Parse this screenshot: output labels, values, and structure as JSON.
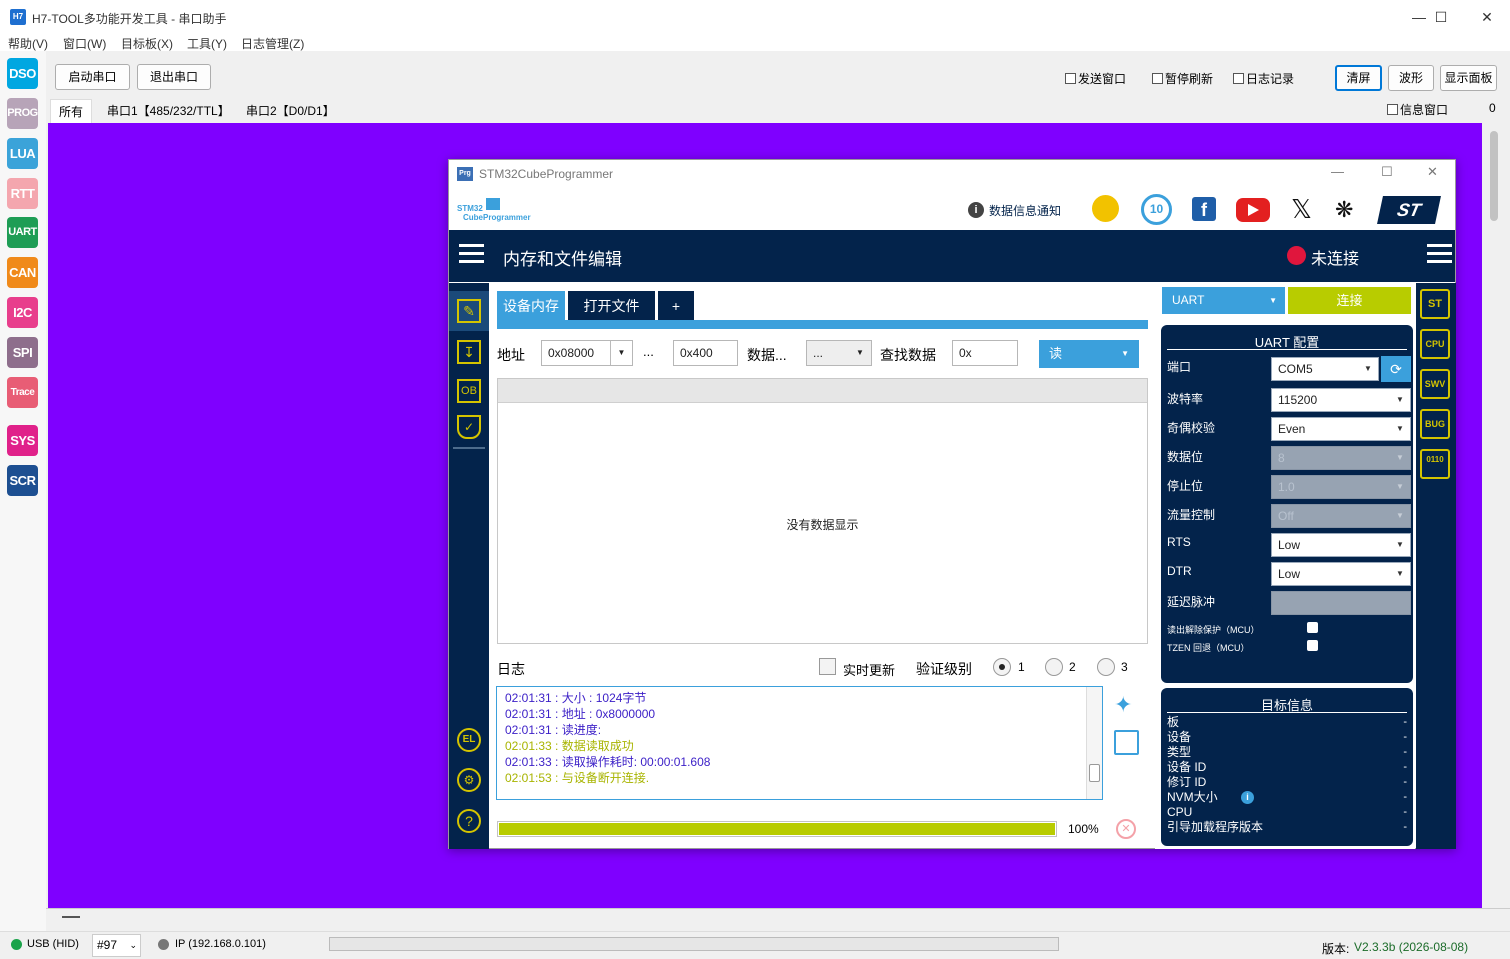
{
  "window": {
    "icon_text": "H7",
    "title": "H7-TOOL多功能开发工具 - 串口助手"
  },
  "menu": [
    "帮助(V)",
    "窗口(W)",
    "目标板(X)",
    "工具(Y)",
    "日志管理(Z)"
  ],
  "left_modes": [
    {
      "label": "DSO",
      "color": "#00a7e1"
    },
    {
      "label": "PROG",
      "color": "#b7a4b8"
    },
    {
      "label": "LUA",
      "color": "#3ba3d9"
    },
    {
      "label": "RTT",
      "color": "#f4a6ae"
    },
    {
      "label": "UART",
      "color": "#1e9d55"
    },
    {
      "label": "CAN",
      "color": "#f08a1a"
    },
    {
      "label": "I2C",
      "color": "#e83e8c"
    },
    {
      "label": "SPI",
      "color": "#8e6e8c"
    },
    {
      "label": "Trace",
      "color": "#e85d75"
    },
    {
      "label": "SYS",
      "color": "#e0218a"
    },
    {
      "label": "SCR",
      "color": "#1d4f91"
    }
  ],
  "toolbar": {
    "start_port": "启动串口",
    "exit_port": "退出串口",
    "send_window": "发送窗口",
    "pause_refresh": "暂停刷新",
    "log_record": "日志记录",
    "clear": "清屏",
    "wave": "波形",
    "show_panel": "显示面板",
    "info_window": "信息窗口",
    "info_count": "0"
  },
  "tabs": [
    "所有",
    "串口1【485/232/TTL】",
    "串口2【D0/D1】"
  ],
  "status": {
    "usb": "USB (HID)",
    "port_num": "#97",
    "ip": "IP (192.168.0.101)",
    "version_label": "版本:",
    "version_value": "V2.3.3b (2026-08-08)"
  },
  "stm": {
    "title": "STM32CubeProgrammer",
    "icon_text": "Prg",
    "logo_line1": "STM32",
    "logo_line2": "CubeProgrammer",
    "info_notice": "数据信息通知",
    "anniv_badge": "10",
    "header_title": "内存和文件编辑",
    "conn_status": "未连接",
    "tab_device_memory": "设备内存",
    "tab_open_file": "打开文件",
    "tab_plus": "+",
    "addr_label": "地址",
    "addr_value": "0x08000",
    "ellipsis": "...",
    "size_value": "0x400",
    "data_label": "数据...",
    "data_width": "...",
    "find_label": "查找数据",
    "find_value": "0x",
    "read_btn": "读",
    "no_data": "没有数据显示",
    "log_label": "日志",
    "realtime_update": "实时更新",
    "verify_level": "验证级别",
    "levels": [
      "1",
      "2",
      "3"
    ],
    "log_lines": [
      {
        "text": "02:01:31 :  大小        : 1024字节",
        "color": "#3b1fc7"
      },
      {
        "text": "02:01:31 :  地址 : 0x8000000",
        "color": "#3b1fc7"
      },
      {
        "text": "02:01:31 : 读进度:",
        "color": "#3b1fc7"
      },
      {
        "text": "02:01:33 : 数据读取成功",
        "color": "#a8b400"
      },
      {
        "text": "02:01:33 : 读取操作耗时:  00:00:01.608",
        "color": "#3b1fc7"
      },
      {
        "text": "02:01:53 : 与设备断开连接.",
        "color": "#a8b400"
      }
    ],
    "progress": 100,
    "progress_text": "100%",
    "conn_type": "UART",
    "connect_btn": "连接",
    "uart_cfg_title": "UART 配置",
    "uart_fields": [
      {
        "label": "端口",
        "value": "COM5",
        "disabled": false
      },
      {
        "label": "波特率",
        "value": "115200",
        "disabled": false
      },
      {
        "label": "奇偶校验",
        "value": "Even",
        "disabled": false
      },
      {
        "label": "数据位",
        "value": "8",
        "disabled": true
      },
      {
        "label": "停止位",
        "value": "1.0",
        "disabled": true
      },
      {
        "label": "流量控制",
        "value": "Off",
        "disabled": true
      },
      {
        "label": "RTS",
        "value": "Low",
        "disabled": false
      },
      {
        "label": "DTR",
        "value": "Low",
        "disabled": false
      },
      {
        "label": "延迟脉冲",
        "value": "",
        "disabled": true
      }
    ],
    "read_unprotect": "读出解除保护（MCU）",
    "tzen_regression": "TZEN 回退（MCU）",
    "target_info_title": "目标信息",
    "target_fields": [
      {
        "label": "板",
        "value": "-"
      },
      {
        "label": "设备",
        "value": "-"
      },
      {
        "label": "类型",
        "value": "-"
      },
      {
        "label": "设备 ID",
        "value": "-"
      },
      {
        "label": "修订 ID",
        "value": "-"
      },
      {
        "label": "NVM大小",
        "value": "-"
      },
      {
        "label": "CPU",
        "value": "-"
      },
      {
        "label": "引导加载程序版本",
        "value": "-"
      }
    ],
    "right_icons": [
      "ST",
      "CPU",
      "SWV",
      "BUG",
      "0110"
    ],
    "ob_label": "OB"
  },
  "colors": {
    "navy": "#03234b",
    "accent_blue": "#3ba0dc",
    "lime": "#b8cc00",
    "purple_bg": "#7f00ff"
  }
}
